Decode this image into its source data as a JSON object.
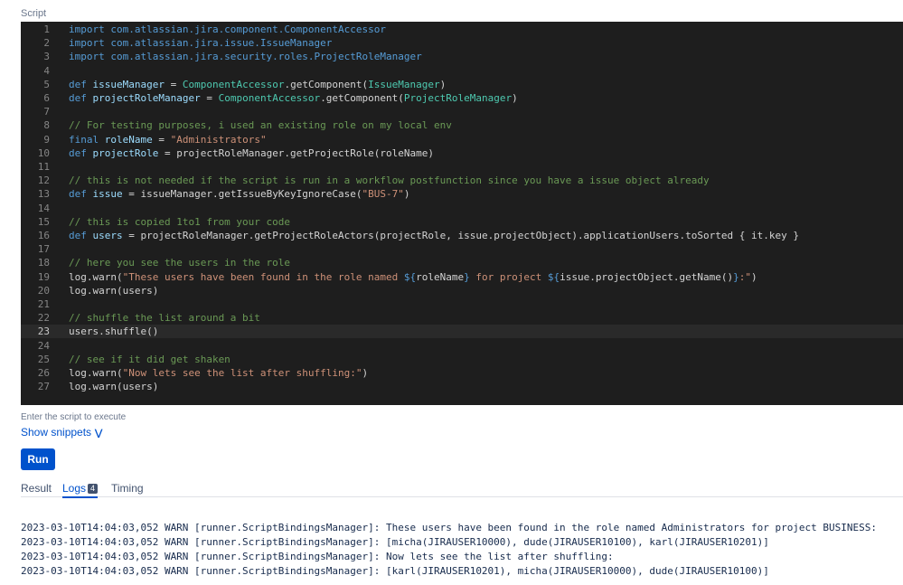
{
  "script_label": "Script",
  "code_lines": [
    [
      [
        "kw",
        "import com.atlassian.jira.component.ComponentAccessor"
      ]
    ],
    [
      [
        "kw",
        "import com.atlassian.jira.issue.IssueManager"
      ]
    ],
    [
      [
        "kw",
        "import com.atlassian.jira.security.roles.ProjectRoleManager"
      ]
    ],
    [],
    [
      [
        "kw",
        "def "
      ],
      [
        "var",
        "issueManager"
      ],
      [
        "pl",
        " = "
      ],
      [
        "type",
        "ComponentAccessor"
      ],
      [
        "pl",
        ".getComponent("
      ],
      [
        "type",
        "IssueManager"
      ],
      [
        "pl",
        ")"
      ]
    ],
    [
      [
        "kw",
        "def "
      ],
      [
        "var",
        "projectRoleManager"
      ],
      [
        "pl",
        " = "
      ],
      [
        "type",
        "ComponentAccessor"
      ],
      [
        "pl",
        ".getComponent("
      ],
      [
        "type",
        "ProjectRoleManager"
      ],
      [
        "pl",
        ")"
      ]
    ],
    [],
    [
      [
        "cm",
        "// For testing purposes, i used an existing role on my local env"
      ]
    ],
    [
      [
        "kw",
        "final "
      ],
      [
        "var",
        "roleName"
      ],
      [
        "pl",
        " = "
      ],
      [
        "str",
        "\"Administrators\""
      ]
    ],
    [
      [
        "kw",
        "def "
      ],
      [
        "var",
        "projectRole"
      ],
      [
        "pl",
        " = projectRoleManager.getProjectRole(roleName)"
      ]
    ],
    [],
    [
      [
        "cm",
        "// this is not needed if the script is run in a workflow postfunction since you have a issue object already"
      ]
    ],
    [
      [
        "kw",
        "def "
      ],
      [
        "var",
        "issue"
      ],
      [
        "pl",
        " = issueManager.getIssueByKeyIgnoreCase("
      ],
      [
        "str",
        "\"BUS-7\""
      ],
      [
        "pl",
        ")"
      ]
    ],
    [],
    [
      [
        "cm",
        "// this is copied 1to1 from your code"
      ]
    ],
    [
      [
        "kw",
        "def "
      ],
      [
        "var",
        "users"
      ],
      [
        "pl",
        " = projectRoleManager.getProjectRoleActors(projectRole, issue.projectObject).applicationUsers.toSorted { it.key }"
      ]
    ],
    [],
    [
      [
        "cm",
        "// here you see the users in the role"
      ]
    ],
    [
      [
        "pl",
        "log.warn("
      ],
      [
        "str",
        "\"These users have been found in the role named "
      ],
      [
        "kw",
        "${"
      ],
      [
        "pl",
        "roleName"
      ],
      [
        "kw",
        "}"
      ],
      [
        "str",
        " for project "
      ],
      [
        "kw",
        "${"
      ],
      [
        "pl",
        "issue.projectObject.getName()"
      ],
      [
        "kw",
        "}"
      ],
      [
        "str",
        ":\""
      ],
      [
        "pl",
        ")"
      ]
    ],
    [
      [
        "pl",
        "log.warn(users)"
      ]
    ],
    [],
    [
      [
        "cm",
        "// shuffle the list around a bit"
      ]
    ],
    [
      [
        "pl",
        "users.shuffle()"
      ]
    ],
    [],
    [
      [
        "cm",
        "// see if it did get shaken"
      ]
    ],
    [
      [
        "pl",
        "log.warn("
      ],
      [
        "str",
        "\"Now lets see the list after shuffling:\""
      ],
      [
        "pl",
        ")"
      ]
    ],
    [
      [
        "pl",
        "log.warn(users)"
      ]
    ]
  ],
  "active_line": 23,
  "hint": "Enter the script to execute",
  "show_snippets": "Show snippets",
  "run_button": "Run",
  "tabs": [
    {
      "label": "Result",
      "active": false
    },
    {
      "label": "Logs",
      "badge": "4",
      "active": true
    },
    {
      "label": "Timing",
      "active": false
    }
  ],
  "logs": [
    "2023-03-10T14:04:03,052 WARN [runner.ScriptBindingsManager]: These users have been found in the role named Administrators for project BUSINESS:",
    "2023-03-10T14:04:03,052 WARN [runner.ScriptBindingsManager]: [micha(JIRAUSER10000), dude(JIRAUSER10100), karl(JIRAUSER10201)]",
    "2023-03-10T14:04:03,052 WARN [runner.ScriptBindingsManager]: Now lets see the list after shuffling:",
    "2023-03-10T14:04:03,052 WARN [runner.ScriptBindingsManager]: [karl(JIRAUSER10201), micha(JIRAUSER10000), dude(JIRAUSER10100)]"
  ]
}
